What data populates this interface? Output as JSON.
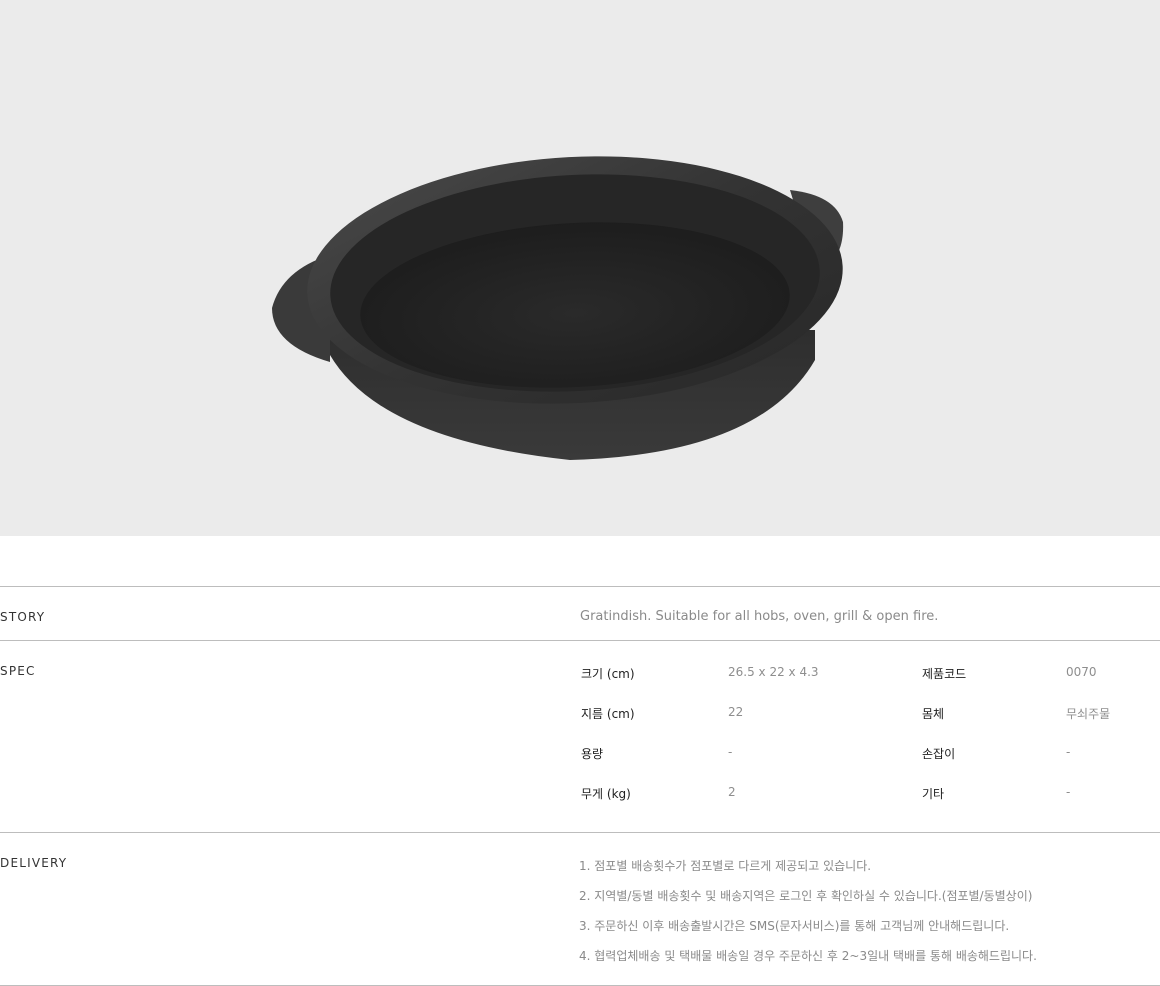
{
  "product": {
    "image_alt": "cast iron gratin dish",
    "colors": {
      "background": "#ebebeb",
      "pan": "#2b2b2b",
      "divider": "#bdbdbd"
    }
  },
  "story": {
    "label": "STORY",
    "text": "Gratindish. Suitable for all hobs, oven, grill & open fire."
  },
  "spec": {
    "label": "SPEC",
    "rows": [
      {
        "k1": "크기 (cm)",
        "v1": "26.5 x 22 x 4.3",
        "k2": "제품코드",
        "v2": "0070"
      },
      {
        "k1": "지름 (cm)",
        "v1": "22",
        "k2": "몸체",
        "v2": "무쇠주물"
      },
      {
        "k1": "용량",
        "v1": "-",
        "k2": "손잡이",
        "v2": "-"
      },
      {
        "k1": "무게 (kg)",
        "v1": "2",
        "k2": "기타",
        "v2": "-"
      }
    ]
  },
  "delivery": {
    "label": "DELIVERY",
    "lines": [
      "1. 점포별 배송횟수가 점포별로 다르게 제공되고 있습니다.",
      "2. 지역별/동별 배송횟수 및 배송지역은 로그인 후 확인하실 수 있습니다.(점포별/동별상이)",
      "3. 주문하신 이후 배송출발시간은 SMS(문자서비스)를 통해 고객님께 안내해드립니다.",
      "4. 협력업체배송 및 택배물 배송일 경우 주문하신 후 2~3일내 택배를 통해 배송해드립니다."
    ]
  }
}
